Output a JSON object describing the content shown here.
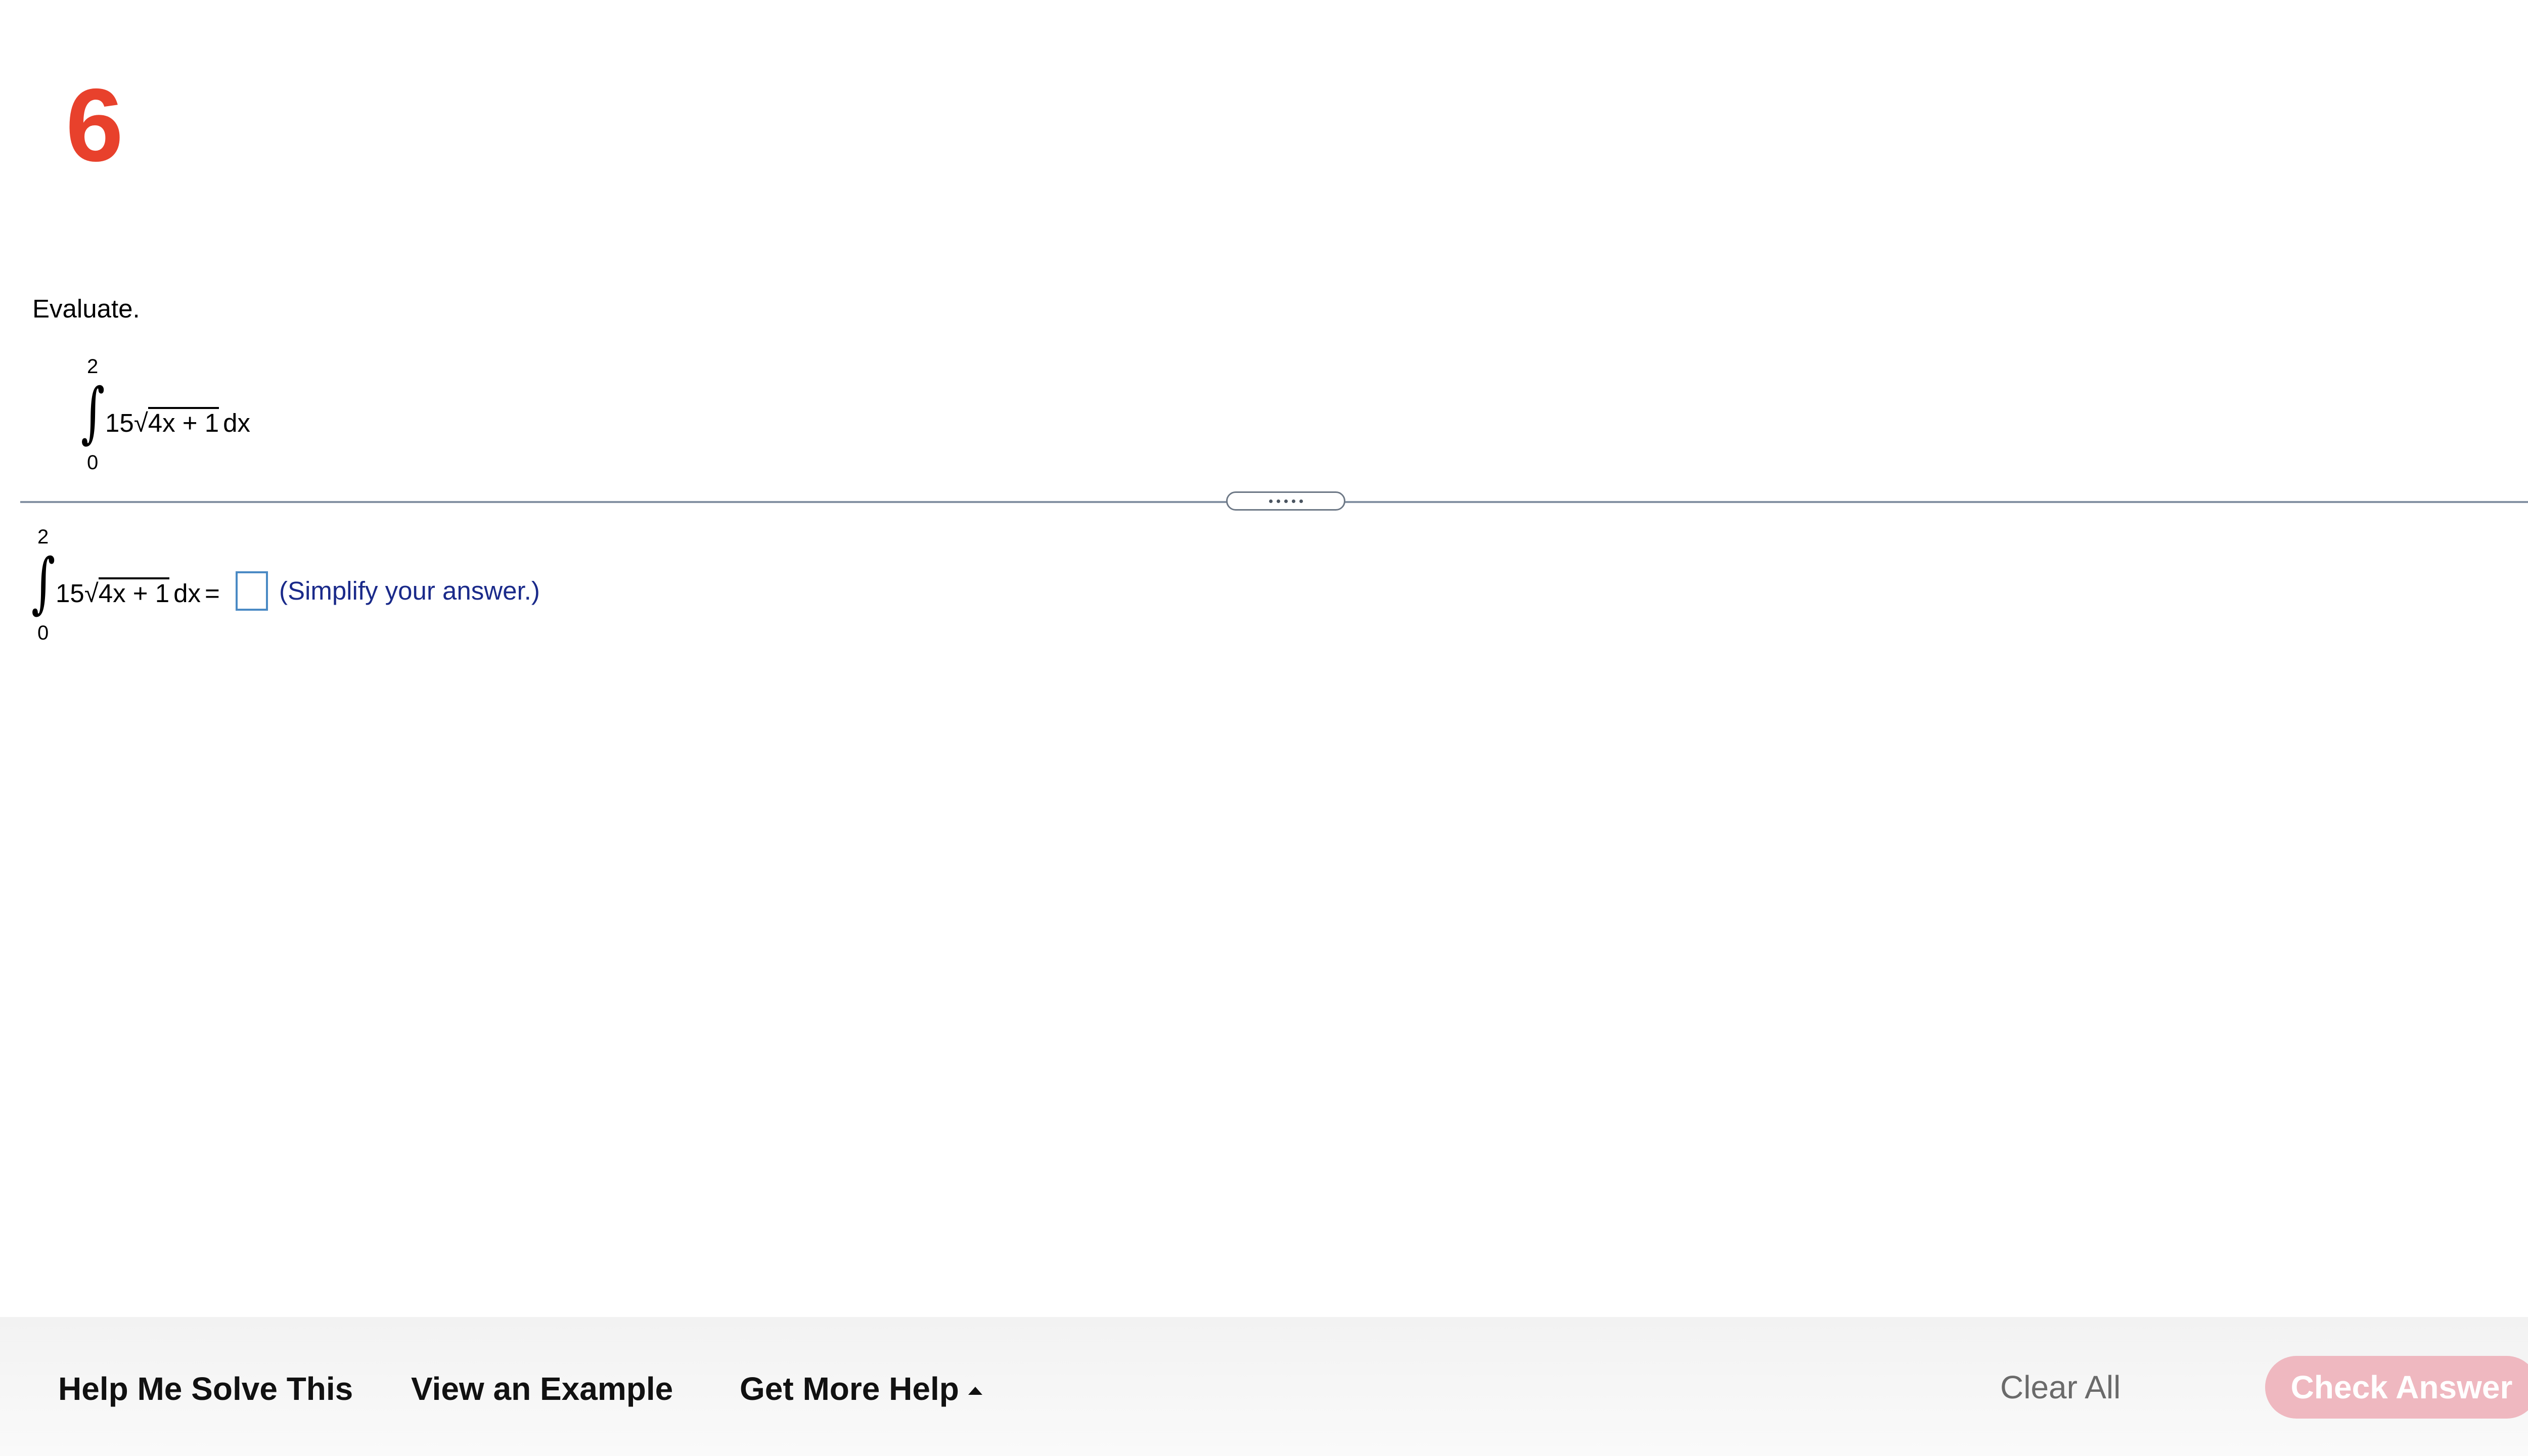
{
  "question": {
    "number": "6",
    "prompt": "Evaluate."
  },
  "problem": {
    "upper_limit": "2",
    "lower_limit": "0",
    "coefficient": "15",
    "radicand": "4x + 1",
    "differential": "dx"
  },
  "answer": {
    "upper_limit": "2",
    "lower_limit": "0",
    "coefficient": "15",
    "radicand": "4x + 1",
    "differential": "dx",
    "equals": "=",
    "input_value": "",
    "hint": "(Simplify your answer.)"
  },
  "footer": {
    "help_me_solve": "Help Me Solve This",
    "view_example": "View an Example",
    "get_more_help": "Get More Help",
    "clear_all": "Clear All",
    "check_answer": "Check Answer"
  },
  "colors": {
    "question_number": "#e8412c",
    "hint_text": "#1a2a8a",
    "check_answer_bg": "#efb8c0",
    "answer_box_border": "#4a8ac4"
  },
  "icons": {
    "get_more_help_caret": "caret-up-icon",
    "divider_handle": "drag-handle-icon"
  }
}
